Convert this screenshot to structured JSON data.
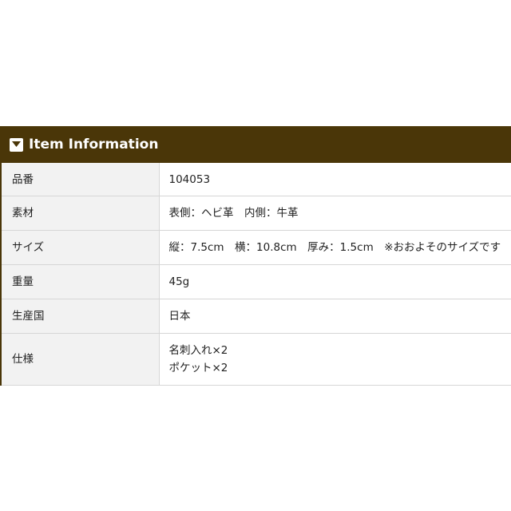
{
  "header": {
    "title": "Item Information",
    "icon": "chevron-down-square-icon"
  },
  "spec": {
    "rows": [
      {
        "label": "品番",
        "value": "104053"
      },
      {
        "label": "素材",
        "value": "表側：ヘビ革　内側：牛革"
      },
      {
        "label": "サイズ",
        "value": "縦：7.5cm　横：10.8cm　厚み：1.5cm　※おおよそのサイズです"
      },
      {
        "label": "重量",
        "value": "45g"
      },
      {
        "label": "生産国",
        "value": "日本"
      },
      {
        "label": "仕様",
        "value_lines": [
          "名刺入れ×2",
          "ポケット×2"
        ]
      }
    ]
  },
  "colors": {
    "header_bg": "#4a3608",
    "label_bg": "#f2f2f2",
    "border": "#d6d6d6"
  }
}
